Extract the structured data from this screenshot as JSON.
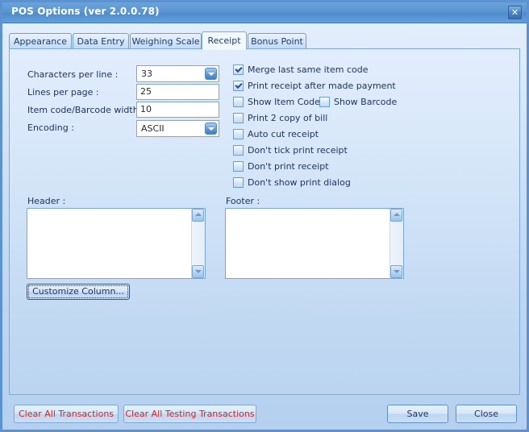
{
  "window": {
    "title": "POS Options (ver 2.0.0.78)",
    "close_icon": "close-icon",
    "close_glyph": "✕"
  },
  "tabs": [
    {
      "label": "Appearance",
      "active": false
    },
    {
      "label": "Data Entry",
      "active": false
    },
    {
      "label": "Weighing Scale",
      "active": false
    },
    {
      "label": "Receipt",
      "active": true
    },
    {
      "label": "Bonus Point",
      "active": false
    }
  ],
  "receipt_tab": {
    "fields": [
      {
        "label": "Characters per line :",
        "value": "33",
        "type": "combobox"
      },
      {
        "label": "Lines per page :",
        "value": "25",
        "type": "textbox"
      },
      {
        "label": "Item code/Barcode width",
        "value": "10",
        "type": "textbox"
      },
      {
        "label": "Encoding :",
        "value": "ASCII",
        "type": "combobox"
      }
    ],
    "checkboxes": [
      {
        "label": "Merge last same item code",
        "checked": true
      },
      {
        "label": "Print receipt after made payment",
        "checked": true
      },
      {
        "label": "Show Item Code",
        "checked": false
      },
      {
        "label": "Show Barcode",
        "checked": false
      },
      {
        "label": "Print 2 copy of bill",
        "checked": false
      },
      {
        "label": "Auto cut receipt",
        "checked": false
      },
      {
        "label": "Don't tick print receipt",
        "checked": false
      },
      {
        "label": "Don't print receipt",
        "checked": false
      },
      {
        "label": "Don't show print dialog",
        "checked": false
      }
    ],
    "header": {
      "label": "Header :",
      "value": ""
    },
    "footer": {
      "label": "Footer :",
      "value": ""
    },
    "customize_column_label": "Customize Column..."
  },
  "footer_bar": {
    "clear_all_transactions": "Clear All Transactions",
    "clear_all_testing_transactions": "Clear All Testing Transactions",
    "save": "Save",
    "close": "Close"
  },
  "colors": {
    "titlebar": "#5b95d2",
    "window_border": "#5c92d0",
    "panel_bg": "#cce0f6",
    "accent_text": "#1c3259",
    "danger_text": "#d42323"
  }
}
